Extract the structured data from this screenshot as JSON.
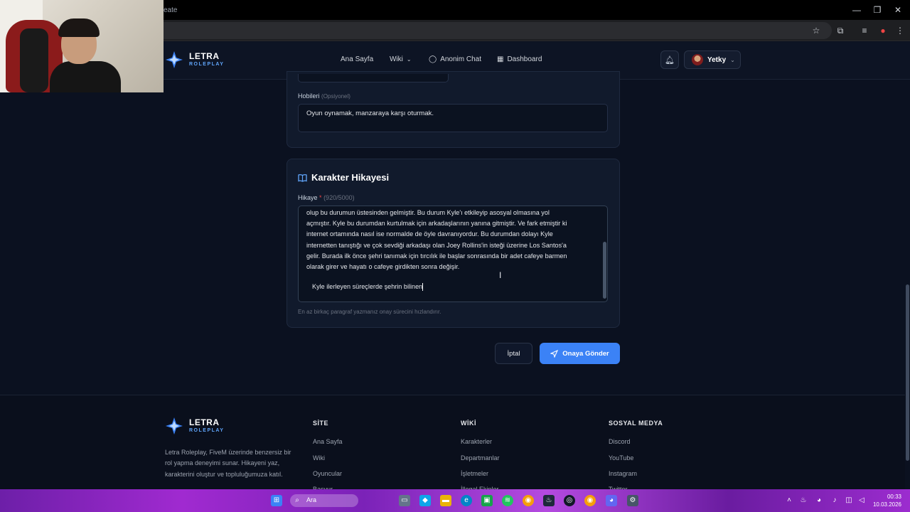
{
  "browser": {
    "url_fragment": "eate"
  },
  "nav": {
    "logo_title": "LETRA",
    "logo_subtitle": "ROLEPLAY",
    "links": [
      "Ana Sayfa",
      "Wiki",
      "Anonim Chat",
      "Dashboard"
    ],
    "user_name": "Yetky"
  },
  "form": {
    "hobbies_label": "Hobileri",
    "hobbies_optional": "(Opsiyonel)",
    "hobbies_value": "Oyun oynamak, manzaraya karşı oturmak.",
    "story_section_title": "Karakter Hikayesi",
    "story_label": "Hikaye",
    "story_required": "*",
    "story_count": "(920/5000)",
    "story_lines": [
      "olup bu durumun üstesinden gelmiştir. Bu durum Kyle'ı etkileyip asosyal olmasına yol",
      "açmıştır. Kyle bu durumdan kurtulmak için arkadaşlarının yanına gitmiştir. Ve fark etmiştir ki",
      "internet ortamında nasıl ise normalde de öyle davranıyordur. Bu durumdan dolayı Kyle",
      "internetten tanıştığı ve çok sevdiği arkadaşı olan Joey Rollins'in isteği üzerine Los Santos'a",
      "gelir. Burada ilk önce şehri tanımak için tırcılık ile başlar sonrasında bir adet cafeye barmen",
      "olarak girer ve hayatı o cafeye girdikten sonra değişir."
    ],
    "story_continuation": "Kyle ilerleyen süreçlerde şehrin bilinen",
    "story_hint": "En az birkaç paragraf yazmanız onay sürecini hızlandırır.",
    "cancel_label": "İptal",
    "submit_label": "Onaya Gönder"
  },
  "footer": {
    "logo_title": "LETRA",
    "logo_subtitle": "ROLEPLAY",
    "description": "Letra Roleplay, FiveM üzerinde benzersiz bir rol yapma deneyimi sunar. Hikayeni yaz, karakterini oluştur ve topluluğumuza katıl.",
    "columns": [
      {
        "heading": "SİTE",
        "links": [
          "Ana Sayfa",
          "Wiki",
          "Oyuncular",
          "Başvur"
        ]
      },
      {
        "heading": "WİKİ",
        "links": [
          "Karakterler",
          "Departmanlar",
          "İşletmeler",
          "İllegal Ekipler"
        ]
      },
      {
        "heading": "SOSYAL MEDYA",
        "links": [
          "Discord",
          "YouTube",
          "Instagram",
          "Twitter"
        ]
      }
    ]
  },
  "taskbar": {
    "search_placeholder": "Ara",
    "time": "00:33",
    "date": "10.03.2026"
  },
  "colors": {
    "background": "#0b1120",
    "card": "#111a2c",
    "accent": "#3b82f6",
    "required": "#ef4444"
  }
}
